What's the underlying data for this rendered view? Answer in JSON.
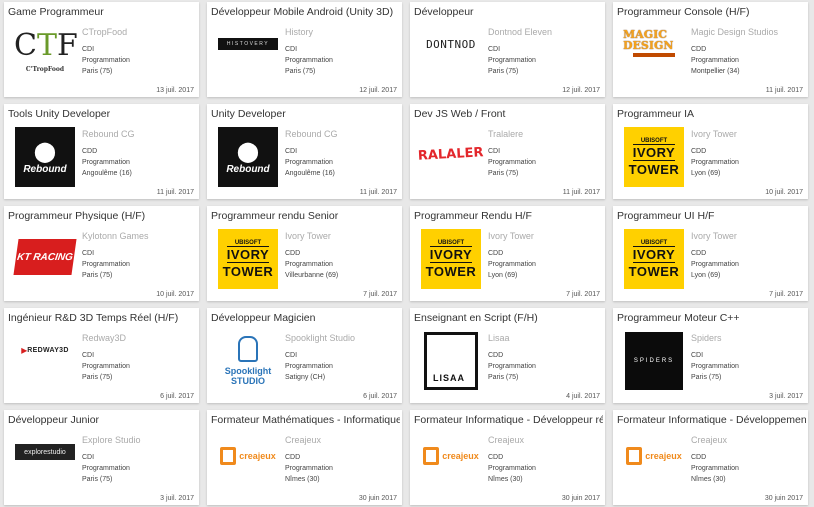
{
  "jobs": [
    {
      "title": "Game Programmeur",
      "company": "CTropFood",
      "contract": "CDI",
      "category": "Programmation",
      "location": "Paris (75)",
      "date": "13 juil. 2017",
      "logo": "ctropfood-logo",
      "logo_text": "C'TropFood"
    },
    {
      "title": "Développeur Mobile Android (Unity 3D)",
      "company": "History",
      "contract": "CDI",
      "category": "Programmation",
      "location": "Paris (75)",
      "date": "12 juil. 2017",
      "logo": "history-logo",
      "logo_text": "HISTOVERY"
    },
    {
      "title": "Développeur",
      "company": "Dontnod Eleven",
      "contract": "CDI",
      "category": "Programmation",
      "location": "Paris (75)",
      "date": "12 juil. 2017",
      "logo": "dontnod-logo",
      "logo_text": "DONTNOD"
    },
    {
      "title": "Programmeur Console (H/F)",
      "company": "Magic Design Studios",
      "contract": "CDD",
      "category": "Programmation",
      "location": "Montpellier (34)",
      "date": "11 juil. 2017",
      "logo": "magic-design-logo",
      "logo_text": "MAGIC DESIGN"
    },
    {
      "title": "Tools Unity Developer",
      "company": "Rebound CG",
      "contract": "CDD",
      "category": "Programmation",
      "location": "Angoulême (16)",
      "date": "11 juil. 2017",
      "logo": "rebound-logo",
      "logo_text": "Rebound"
    },
    {
      "title": "Unity Developer",
      "company": "Rebound CG",
      "contract": "CDI",
      "category": "Programmation",
      "location": "Angoulême (16)",
      "date": "11 juil. 2017",
      "logo": "rebound-logo",
      "logo_text": "Rebound"
    },
    {
      "title": "Dev JS Web / Front",
      "company": "Tralalere",
      "contract": "CDI",
      "category": "Programmation",
      "location": "Paris (75)",
      "date": "11 juil. 2017",
      "logo": "tralalere-logo",
      "logo_text": "TRALALERE"
    },
    {
      "title": "Programmeur IA",
      "company": "Ivory Tower",
      "contract": "CDD",
      "category": "Programmation",
      "location": "Lyon (69)",
      "date": "10 juil. 2017",
      "logo": "ivory-tower-logo",
      "logo_text": "IVORY TOWER"
    },
    {
      "title": "Programmeur Physique (H/F)",
      "company": "Kylotonn Games",
      "contract": "CDI",
      "category": "Programmation",
      "location": "Paris (75)",
      "date": "10 juil. 2017",
      "logo": "kt-racing-logo",
      "logo_text": "KT RACING"
    },
    {
      "title": "Programmeur rendu Senior",
      "company": "Ivory Tower",
      "contract": "CDD",
      "category": "Programmation",
      "location": "Villeurbanne (69)",
      "date": "7 juil. 2017",
      "logo": "ivory-tower-logo",
      "logo_text": "IVORY TOWER"
    },
    {
      "title": "Programmeur Rendu H/F",
      "company": "Ivory Tower",
      "contract": "CDD",
      "category": "Programmation",
      "location": "Lyon (69)",
      "date": "7 juil. 2017",
      "logo": "ivory-tower-logo",
      "logo_text": "IVORY TOWER"
    },
    {
      "title": "Programmeur UI H/F",
      "company": "Ivory Tower",
      "contract": "CDD",
      "category": "Programmation",
      "location": "Lyon (69)",
      "date": "7 juil. 2017",
      "logo": "ivory-tower-logo",
      "logo_text": "IVORY TOWER"
    },
    {
      "title": "Ingénieur R&D 3D Temps Réel (H/F)",
      "company": "Redway3D",
      "contract": "CDI",
      "category": "Programmation",
      "location": "Paris (75)",
      "date": "6 juil. 2017",
      "logo": "redway3d-logo",
      "logo_text": "REDWAY3D"
    },
    {
      "title": "Développeur Magicien",
      "company": "Spooklight Studio",
      "contract": "CDI",
      "category": "Programmation",
      "location": "Satigny (CH)",
      "date": "6 juil. 2017",
      "logo": "spooklight-logo",
      "logo_text": "Spooklight STUDIO"
    },
    {
      "title": "Enseignant en Script (F/H)",
      "company": "Lisaa",
      "contract": "CDD",
      "category": "Programmation",
      "location": "Paris (75)",
      "date": "4 juil. 2017",
      "logo": "lisaa-logo",
      "logo_text": "LISAA"
    },
    {
      "title": "Programmeur Moteur C++",
      "company": "Spiders",
      "contract": "CDI",
      "category": "Programmation",
      "location": "Paris (75)",
      "date": "3 juil. 2017",
      "logo": "spiders-logo",
      "logo_text": "SPIDERS"
    },
    {
      "title": "Développeur Junior",
      "company": "Explore Studio",
      "contract": "CDI",
      "category": "Programmation",
      "location": "Paris (75)",
      "date": "3 juil. 2017",
      "logo": "explore-studio-logo",
      "logo_text": "explorestudio"
    },
    {
      "title": "Formateur Mathématiques - Informatique H/F",
      "company": "Creajeux",
      "contract": "CDD",
      "category": "Programmation",
      "location": "Nîmes (30)",
      "date": "30 juin 2017",
      "logo": "creajeux-logo",
      "logo_text": "creajeux"
    },
    {
      "title": "Formateur Informatique - Développeur réseau",
      "company": "Creajeux",
      "contract": "CDD",
      "category": "Programmation",
      "location": "Nîmes (30)",
      "date": "30 juin 2017",
      "logo": "creajeux-logo",
      "logo_text": "creajeux"
    },
    {
      "title": "Formateur Informatique - Développement Outils",
      "company": "Creajeux",
      "contract": "CDD",
      "category": "Programmation",
      "location": "Nîmes (30)",
      "date": "30 juin 2017",
      "logo": "creajeux-logo",
      "logo_text": "creajeux"
    }
  ],
  "colors": {
    "page_bg": "#e8e8e8",
    "card_bg": "#ffffff",
    "company_text": "#aaaaaa",
    "ivory_yellow": "#ffd000",
    "kt_red": "#d81e1e",
    "tralalere_red": "#e3262b",
    "creajeux_orange": "#f08a1c",
    "spooklight_blue": "#2a74b8",
    "magic_orange": "#f5a21c"
  }
}
